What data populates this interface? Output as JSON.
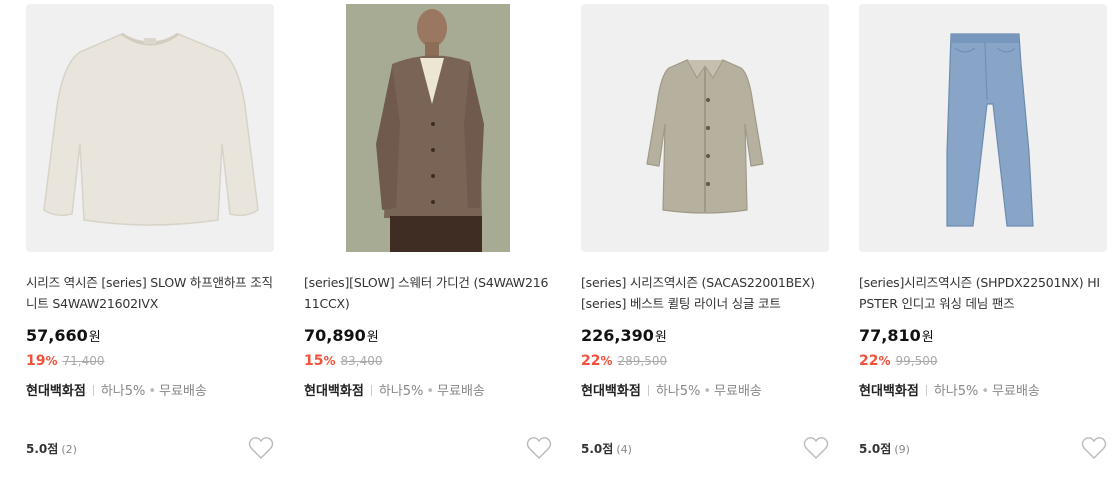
{
  "products": [
    {
      "image": "ivory-sweater-photo",
      "title": "시리즈 역시즌 [series] SLOW 하프앤하프 조직 니트 S4WAW21602IVX",
      "price": "57,660",
      "currency": "원",
      "discount_rate": "19",
      "percent_sign": "%",
      "original_price": "71,400",
      "store": "현대백화점",
      "benefit_card": "하나5%",
      "benefit_bullet": "•",
      "benefit_shipping": "무료배송",
      "rating": "5.0점",
      "review_count": "(2)"
    },
    {
      "image": "model-brown-cardigan-photo",
      "title": "[series][SLOW] 스웨터 가디건 (S4WAW21611CCX)",
      "price": "70,890",
      "currency": "원",
      "discount_rate": "15",
      "percent_sign": "%",
      "original_price": "83,400",
      "store": "현대백화점",
      "benefit_card": "하나5%",
      "benefit_bullet": "•",
      "benefit_shipping": "무료배송",
      "rating": "",
      "review_count": ""
    },
    {
      "image": "beige-quilted-coat-photo",
      "title": "[series] 시리즈역시즌 (SACAS22001BEX) [series] 베스트 퀼팅 라이너 싱글 코트",
      "price": "226,390",
      "currency": "원",
      "discount_rate": "22",
      "percent_sign": "%",
      "original_price": "289,500",
      "store": "현대백화점",
      "benefit_card": "하나5%",
      "benefit_bullet": "•",
      "benefit_shipping": "무료배송",
      "rating": "5.0점",
      "review_count": "(4)"
    },
    {
      "image": "indigo-denim-pants-photo",
      "title": "[series]시리즈역시즌 (SHPDX22501NX) HIPSTER 인디고 워싱 데님 팬즈",
      "price": "77,810",
      "currency": "원",
      "discount_rate": "22",
      "percent_sign": "%",
      "original_price": "99,500",
      "store": "현대백화점",
      "benefit_card": "하나5%",
      "benefit_bullet": "•",
      "benefit_shipping": "무료배송",
      "rating": "5.0점",
      "review_count": "(9)"
    }
  ],
  "colors": {
    "discount": "#f2523b",
    "thumb_bg": "#f2f2f2",
    "heart_stroke": "#bbbbbb"
  },
  "icons": {
    "wishlist": "heart-outline-icon"
  }
}
